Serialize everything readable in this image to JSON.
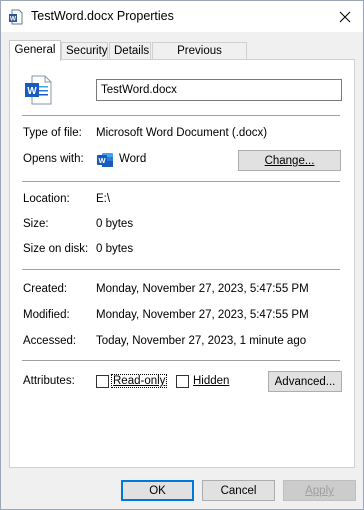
{
  "window": {
    "title": "TestWord.docx Properties"
  },
  "tabs": [
    {
      "label": "General"
    },
    {
      "label": "Security"
    },
    {
      "label": "Details"
    },
    {
      "label": "Previous Versions"
    }
  ],
  "general": {
    "file_name": "TestWord.docx",
    "type_label": "Type of file:",
    "type_value": "Microsoft Word Document (.docx)",
    "opens_label": "Opens with:",
    "opens_value": "Word",
    "change_button": "Change...",
    "location_label": "Location:",
    "location_value": "E:\\",
    "size_label": "Size:",
    "size_value": "0 bytes",
    "size_on_disk_label": "Size on disk:",
    "size_on_disk_value": "0 bytes",
    "created_label": "Created:",
    "created_value": "Monday, November 27, 2023, 5:47:55 PM",
    "modified_label": "Modified:",
    "modified_value": "Monday, November 27, 2023, 5:47:55 PM",
    "accessed_label": "Accessed:",
    "accessed_value": "Today, November 27, 2023, 1 minute ago",
    "attributes_label": "Attributes:",
    "readonly_label": "Read-only",
    "hidden_label": "Hidden",
    "advanced_button": "Advanced..."
  },
  "footer": {
    "ok": "OK",
    "cancel": "Cancel",
    "apply": "Apply"
  },
  "colors": {
    "word_blue": "#2b579a",
    "accent": "#0078d7"
  }
}
